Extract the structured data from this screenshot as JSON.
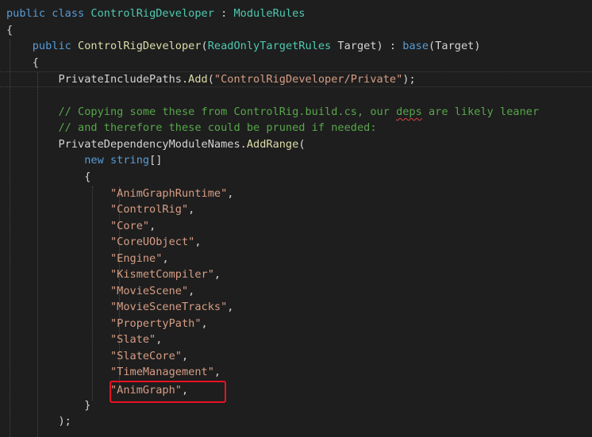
{
  "code": {
    "class_decl": {
      "kw_public": "public",
      "kw_class": "class",
      "class_name": "ControlRigDeveloper",
      "colon": " : ",
      "base_name": "ModuleRules"
    },
    "open_brace": "{",
    "ctor": {
      "kw_public": "public",
      "name": "ControlRigDeveloper",
      "param_type": "ReadOnlyTargetRules",
      "param_name": "Target",
      "colon": " : ",
      "kw_base": "base",
      "base_arg": "Target"
    },
    "ctor_open_brace": "{",
    "include_line": {
      "target": "PrivateIncludePaths",
      "method": "Add",
      "arg": "\"ControlRigDeveloper/Private\""
    },
    "comment_1_pre": "// Copying some these from ControlRig.build.cs, our ",
    "comment_1_squiggle": "deps",
    "comment_1_post": " are likely leaner",
    "comment_2": "// and therefore these could be pruned if needed:",
    "dep_line": {
      "target": "PrivateDependencyModuleNames",
      "method": "AddRange"
    },
    "new_line": {
      "kw_new": "new",
      "kw_string": "string",
      "brackets": "[]"
    },
    "array_open": "{",
    "modules": [
      "\"AnimGraphRuntime\"",
      "\"ControlRig\"",
      "\"Core\"",
      "\"CoreUObject\"",
      "\"Engine\"",
      "\"KismetCompiler\"",
      "\"MovieScene\"",
      "\"MovieSceneTracks\"",
      "\"PropertyPath\"",
      "\"Slate\"",
      "\"SlateCore\"",
      "\"TimeManagement\"",
      "\"AnimGraph\""
    ],
    "array_close": "}",
    "call_close": ");"
  },
  "colors": {
    "background": "#1e1e1e",
    "keyword": "#569cd6",
    "type": "#4ec9b0",
    "function": "#dcdcaa",
    "string": "#d69d85",
    "comment": "#57a64a",
    "highlight_box": "#e81123"
  }
}
